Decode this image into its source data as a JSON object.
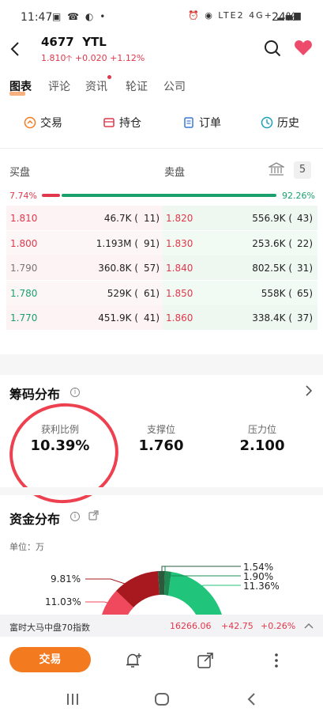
{
  "status_bar": {
    "time": "11:47",
    "left_icons": "▣ ☎ ◐ •",
    "right_icons": "⏰ ◉ LTE2 4G+ ▂▄▆",
    "battery": "24%"
  },
  "header": {
    "code": "4677",
    "name": "YTL",
    "price": "1.810",
    "change": "+0.020",
    "change_pct": "+1.12%"
  },
  "tabs": [
    {
      "label": "图表",
      "active": true
    },
    {
      "label": "评论"
    },
    {
      "label": "资讯"
    },
    {
      "label": "轮证"
    },
    {
      "label": "公司"
    }
  ],
  "actions": [
    {
      "label": "交易",
      "icon": "trade-icon"
    },
    {
      "label": "持仓",
      "icon": "position-icon"
    },
    {
      "label": "订单",
      "icon": "order-icon"
    },
    {
      "label": "历史",
      "icon": "history-icon"
    }
  ],
  "orderbook": {
    "bid_title": "买盘",
    "ask_title": "卖盘",
    "bid_pct": "7.74%",
    "ask_pct": "92.26%",
    "bid_ratio": 0.0774,
    "levels_icon": "5",
    "rows": [
      {
        "bid_price": "1.810",
        "bid_vol": "46.7K (",
        "bid_cnt": "11)",
        "ask_price": "1.820",
        "ask_vol": "556.9K (",
        "ask_cnt": "43)",
        "bid_color": "#e0384b"
      },
      {
        "bid_price": "1.800",
        "bid_vol": "1.193M (",
        "bid_cnt": "91)",
        "ask_price": "1.830",
        "ask_vol": "253.6K (",
        "ask_cnt": "22)",
        "bid_color": "#e0384b"
      },
      {
        "bid_price": "1.790",
        "bid_vol": "360.8K (",
        "bid_cnt": "57)",
        "ask_price": "1.840",
        "ask_vol": "802.5K (",
        "ask_cnt": "31)",
        "bid_color": "#777777"
      },
      {
        "bid_price": "1.780",
        "bid_vol": "529K (",
        "bid_cnt": "61)",
        "ask_price": "1.850",
        "ask_vol": "558K (",
        "ask_cnt": "65)",
        "bid_color": "#1aa06d"
      },
      {
        "bid_price": "1.770",
        "bid_vol": "451.9K (",
        "bid_cnt": "41)",
        "ask_price": "1.860",
        "ask_vol": "338.4K (",
        "ask_cnt": "37)",
        "bid_color": "#1aa06d"
      }
    ]
  },
  "chips": {
    "title": "筹码分布",
    "items": [
      {
        "label": "获利比例",
        "value": "10.39%"
      },
      {
        "label": "支撑位",
        "value": "1.760"
      },
      {
        "label": "压力位",
        "value": "2.100"
      }
    ]
  },
  "funds": {
    "title": "资金分布",
    "unit": "单位：万",
    "left_labels": [
      "9.81%",
      "11.03%"
    ],
    "right_labels": [
      "1.54%",
      "1.90%",
      "11.36%"
    ]
  },
  "ticker": {
    "name": "富时大马中盘70指数",
    "value": "16266.06",
    "change": "+42.75",
    "change_pct": "+0.26%"
  },
  "bottom": {
    "trade_label": "交易"
  },
  "colors": {
    "up": "#e0384b",
    "down": "#1aa06d",
    "accent": "#f47a20"
  }
}
